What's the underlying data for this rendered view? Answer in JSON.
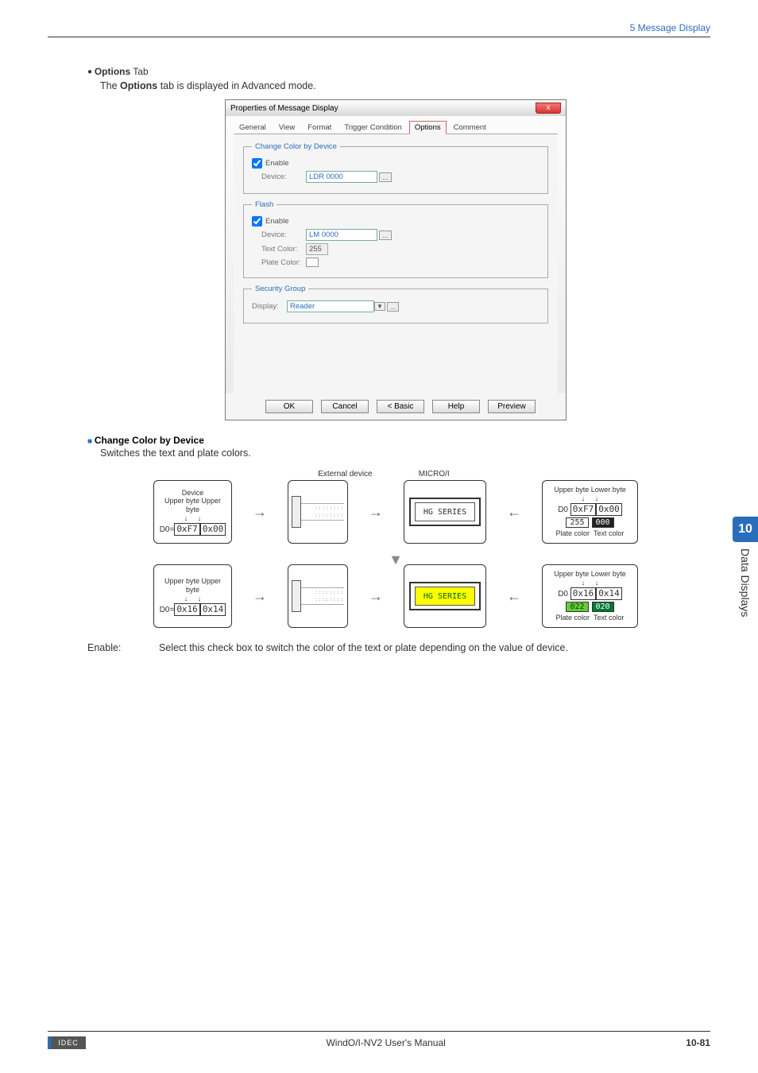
{
  "header": {
    "section": "5 Message Display"
  },
  "title": {
    "bold": "Options",
    "tail": " Tab"
  },
  "intro": {
    "pre": "The ",
    "bold": "Options",
    "post": " tab is displayed in Advanced mode."
  },
  "dialog": {
    "title": "Properties of Message Display",
    "close": "x",
    "tabs": [
      "General",
      "View",
      "Format",
      "Trigger Condition",
      "Options",
      "Comment"
    ],
    "activeTab": 4,
    "group_ccbd": {
      "legend": "Change Color by Device",
      "enable": "Enable",
      "deviceLabel": "Device:",
      "deviceVal": "LDR 0000"
    },
    "group_flash": {
      "legend": "Flash",
      "enable": "Enable",
      "deviceLabel": "Device:",
      "deviceVal": "LM 0000",
      "textColorLabel": "Text Color:",
      "textColorVal": "255",
      "plateColorLabel": "Plate Color:"
    },
    "group_sec": {
      "legend": "Security Group",
      "displayLabel": "Display:",
      "displayVal": "Reader"
    },
    "buttons": {
      "ok": "OK",
      "cancel": "Cancel",
      "basic": "< Basic",
      "help": "Help",
      "preview": "Preview"
    }
  },
  "subhead": {
    "text": "Change Color by Device"
  },
  "subtext": "Switches the text and plate colors.",
  "diagram": {
    "deviceLabel": "Device",
    "extLabel": "External device",
    "microLabel": "MICRO/I",
    "upper": "Upper byte",
    "lower": "Lower byte",
    "row1": {
      "d0": "D0=",
      "b1": "0xF7",
      "b2": "0x00",
      "screen": "HG SERIES",
      "rd0": "D0",
      "rb1": "0xF7",
      "rb2": "0x00",
      "sw1": "255",
      "sw2": "000",
      "plate": "Plate color",
      "text": "Text color"
    },
    "row2": {
      "d0": "D0=",
      "b1": "0x16",
      "b2": "0x14",
      "screen": "HG SERIES",
      "rd0": "D0",
      "rb1": "0x16",
      "rb2": "0x14",
      "sw1": "022",
      "sw2": "020",
      "plate": "Plate color",
      "text": "Text color"
    }
  },
  "def": {
    "term": "Enable:",
    "text": "Select this check box to switch the color of the text or plate depending on the value of device."
  },
  "sidetab": {
    "num": "10",
    "text": "Data Displays"
  },
  "footer": {
    "brand": "IDEC",
    "center": "WindO/I-NV2 User's Manual",
    "page": "10-81"
  }
}
